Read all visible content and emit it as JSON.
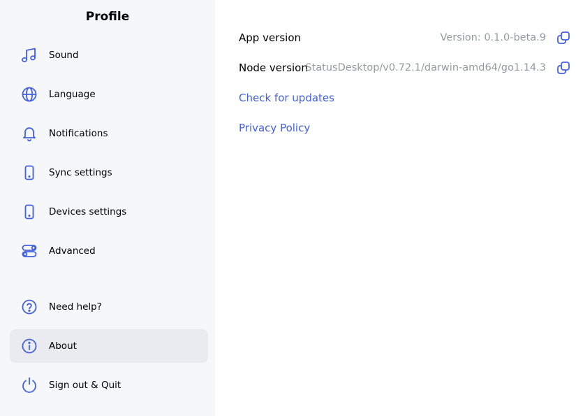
{
  "sidebar": {
    "title": "Profile",
    "items": [
      {
        "label": "Sound",
        "icon": "music-note-icon"
      },
      {
        "label": "Language",
        "icon": "globe-icon"
      },
      {
        "label": "Notifications",
        "icon": "bell-icon"
      },
      {
        "label": "Sync settings",
        "icon": "phone-icon"
      },
      {
        "label": "Devices settings",
        "icon": "phone-icon"
      },
      {
        "label": "Advanced",
        "icon": "toggles-icon"
      },
      {
        "label": "Need help?",
        "icon": "help-circle-icon"
      },
      {
        "label": "About",
        "icon": "info-circle-icon",
        "active": true
      },
      {
        "label": "Sign out & Quit",
        "icon": "power-icon"
      }
    ]
  },
  "main": {
    "app_version": {
      "label": "App version",
      "value": "Version: 0.1.0-beta.9"
    },
    "node_version": {
      "label": "Node version",
      "value": "StatusDesktop/v0.72.1/darwin-amd64/go1.14.3"
    },
    "check_updates": "Check for updates",
    "privacy_policy": "Privacy Policy"
  },
  "colors": {
    "accent": "#4360df",
    "sidebar_bg": "#f6f7f9",
    "active_bg": "#e9ebf0",
    "muted_text": "#939ba1"
  }
}
